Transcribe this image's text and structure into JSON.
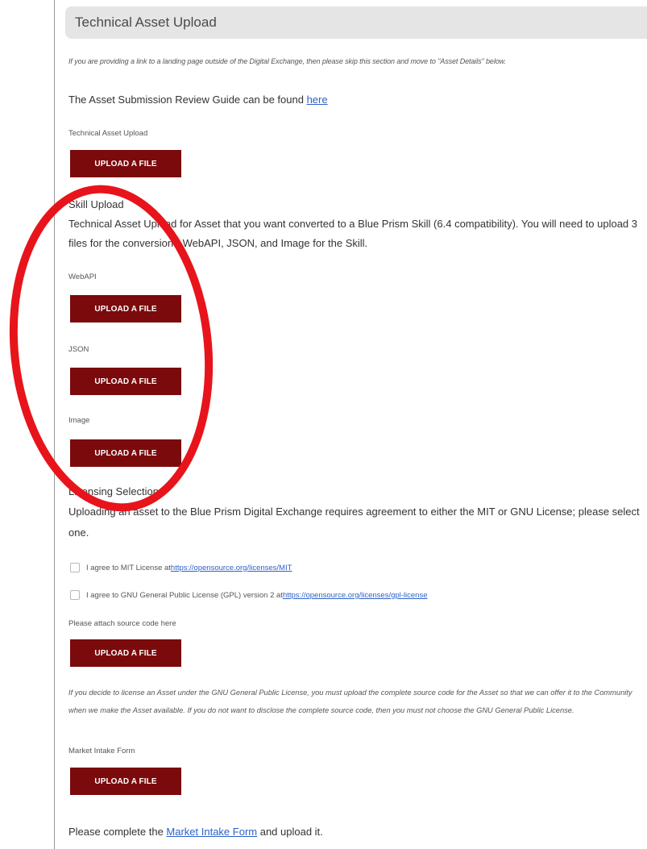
{
  "section": {
    "title": "Technical Asset Upload",
    "skip_note": "If you are providing a link to a landing page outside of the Digital Exchange, then please skip this section and move to \"Asset Details\" below.",
    "review_guide_text": "The Asset Submission Review Guide can be found ",
    "review_guide_link": "here",
    "upload_label": "Technical Asset Upload",
    "upload_button": "UPLOAD A FILE"
  },
  "skill": {
    "title": "Skill Upload",
    "description": "Technical Asset Upload for Asset that you want converted to a Blue Prism Skill (6.4 compatibility). You will need to upload 3 files for the conversion - WebAPI, JSON, and Image for the Skill.",
    "webapi_label": "WebAPI",
    "webapi_button": "UPLOAD A FILE",
    "json_label": "JSON",
    "json_button": "UPLOAD A FILE",
    "image_label": "Image",
    "image_button": "UPLOAD A FILE"
  },
  "licensing": {
    "title": "Licensing Selection",
    "description": "Uploading an asset to the Blue Prism Digital Exchange requires agreement to either the MIT or GNU License; please select one.",
    "mit_text": "I agree to MIT License at ",
    "mit_link": "https://opensource.org/licenses/MIT",
    "gpl_text": "I agree to GNU General Public License (GPL) version 2 at ",
    "gpl_link": "https://opensource.org/licenses/gpl-license",
    "source_label": "Please attach source code here",
    "source_button": "UPLOAD A FILE",
    "gpl_note": "If you decide to license an Asset under the GNU General Public License, you must upload the complete source code for the Asset so that we can offer it to the Community when we make the Asset available. If you do not want to disclose the complete source code, then you must not choose the GNU General Public License."
  },
  "market": {
    "label": "Market Intake Form",
    "button": "UPLOAD A FILE",
    "complete_prefix": "Please complete the ",
    "complete_link": "Market Intake Form",
    "complete_suffix": " and upload it."
  },
  "colors": {
    "button_bg": "#7b0a0c",
    "link": "#2d62c8",
    "annotation": "#e8141b",
    "header_bg": "#e5e5e5"
  }
}
